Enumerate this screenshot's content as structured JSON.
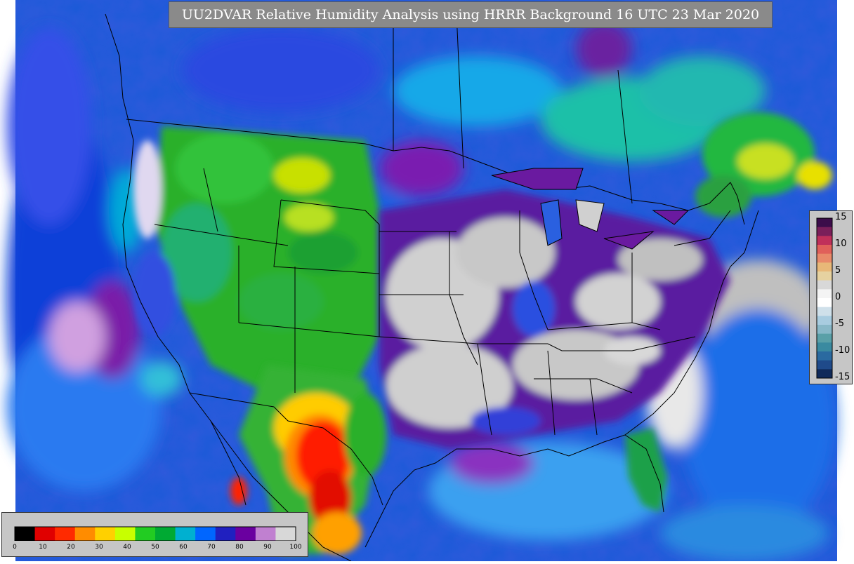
{
  "title": "UU2DVAR Relative Humidity Analysis using HRRR Background 16 UTC 23 Mar 2020",
  "map": {
    "region": "Continental United States, southern Canada, northern Mexico",
    "field": "relative humidity"
  },
  "legend_rh": {
    "ticks": [
      "0",
      "10",
      "20",
      "30",
      "40",
      "50",
      "60",
      "70",
      "80",
      "90",
      "100"
    ],
    "colors": [
      "#000000",
      "#e00000",
      "#ff2a00",
      "#ff8c00",
      "#ffd000",
      "#c8ff00",
      "#22cc22",
      "#00aa33",
      "#00b0d0",
      "#0066ff",
      "#2020c0",
      "#6a00a0",
      "#c080d0",
      "#d8d8d8"
    ]
  },
  "legend_diff": {
    "ticks": [
      "15",
      "10",
      "5",
      "0",
      "-5",
      "-10",
      "-15"
    ],
    "colors": [
      "#3b0d4a",
      "#7a1f5a",
      "#c0305a",
      "#e0605a",
      "#e88a6a",
      "#e8b878",
      "#e6d2a0",
      "#d8d8d8",
      "#f4f4f4",
      "#ffffff",
      "#cfe0ea",
      "#a8cce0",
      "#88b8c8",
      "#5aa0a8",
      "#3a8aa0",
      "#2a6aa0",
      "#1f4a8a",
      "#102a5a"
    ]
  }
}
